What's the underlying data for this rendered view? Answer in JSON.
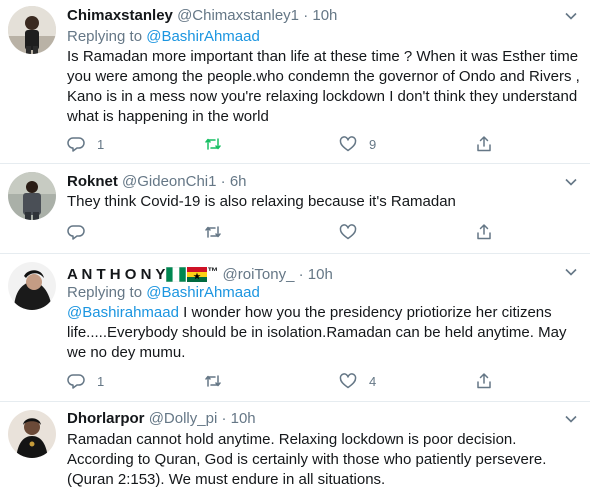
{
  "tweets": [
    {
      "name": "Chimaxstanley",
      "handle": "@Chimaxstanley1",
      "sep": "·",
      "time": "10h",
      "replying_prefix": "Replying to ",
      "replying_to": "@BashirAhmaad",
      "text": "Is Ramadan more important than life at these time ? When it was Esther time you were among the people.who condemn the governor of Ondo and Rivers , Kano is in a mess now you're relaxing lockdown I don't think they understand what is happening in the world",
      "reply_count": "1",
      "retweet_count": "",
      "like_count": "9"
    },
    {
      "name": "Roknet",
      "handle": "@GideonChi1",
      "sep": "·",
      "time": "6h",
      "text": "They think Covid-19 is also relaxing because it's Ramadan",
      "reply_count": "",
      "retweet_count": "",
      "like_count": ""
    },
    {
      "name": "A N T H O N Y",
      "name_suffix": "™",
      "handle": "@roiTony_",
      "sep": "·",
      "time": "10h",
      "replying_prefix": "Replying to ",
      "replying_to": "@BashirAhmaad",
      "mention": "@Bashirahmaad",
      "text": " I wonder how you the presidency priotiorize her citizens life.....Everybody should be in isolation.Ramadan can be held anytime. May we no dey mumu.",
      "reply_count": "1",
      "retweet_count": "",
      "like_count": "4"
    },
    {
      "name": "Dhorlarpor",
      "handle": "@Dolly_pi",
      "sep": "·",
      "time": "10h",
      "text": "Ramadan cannot hold anytime. Relaxing lockdown is poor decision. According to Quran,  God is certainly with those who patiently persevere. (Quran 2:153). We must endure in all situations."
    }
  ],
  "colors": {
    "text": "#14171a",
    "muted": "#657786",
    "link": "#1b95e0",
    "divider": "#e6ecf0"
  },
  "icons": [
    "reply-icon",
    "retweet-icon",
    "like-icon",
    "share-icon",
    "more-caret-icon",
    "nigeria-flag-icon",
    "ghana-flag-icon"
  ]
}
